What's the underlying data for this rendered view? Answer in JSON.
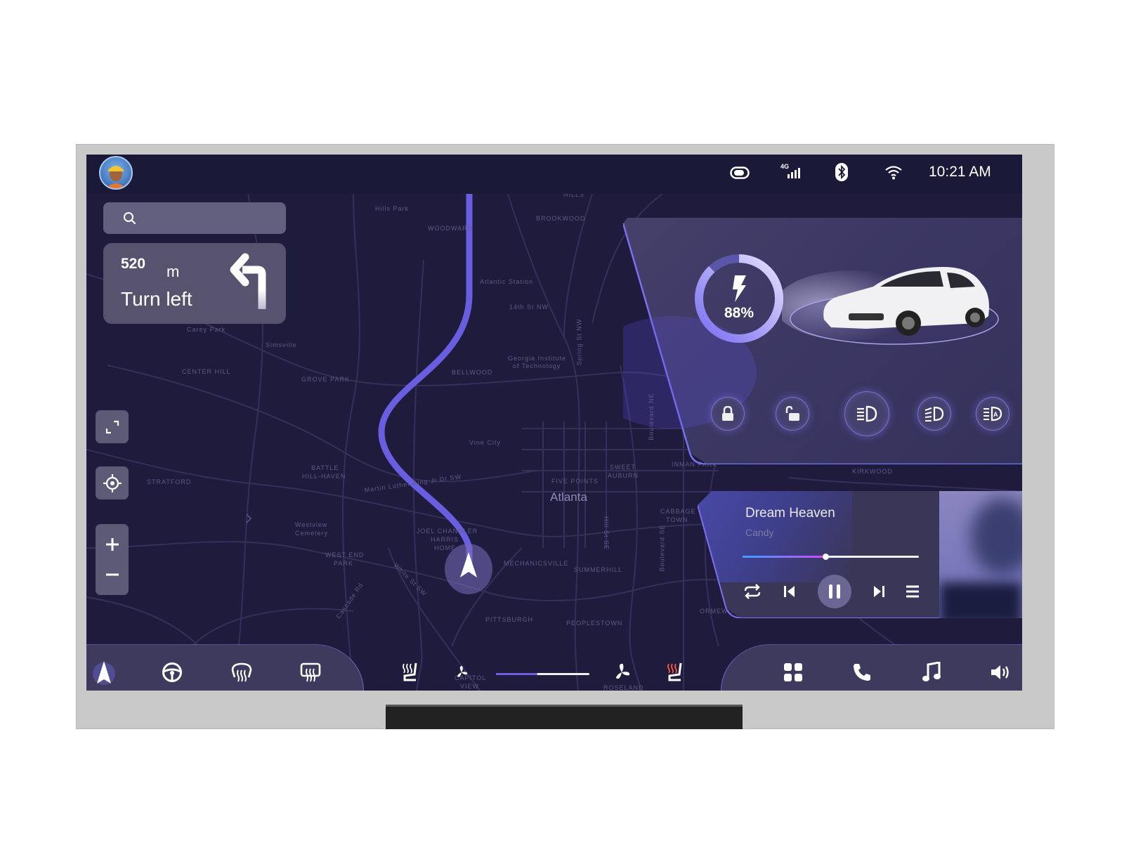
{
  "status_bar": {
    "icons": [
      "toggle-icon",
      "4g-signal-icon",
      "bluetooth-icon",
      "wifi-icon"
    ],
    "signal_label": "4G",
    "time": "10:21 AM"
  },
  "search": {
    "placeholder": "",
    "value": ""
  },
  "navigation": {
    "distance": "520",
    "unit": "m",
    "instruction": "Turn left",
    "maneuver_icon": "turn-left-arrow-icon"
  },
  "map": {
    "city_label": "Atlanta",
    "labels": [
      "Hills Park",
      "WOODWARD",
      "BROOKWOOD",
      "HILLS",
      "Atlantic Station",
      "14th St NW",
      "Georgia Institute",
      "of Technology",
      "BELLWOOD",
      "Simsville",
      "CENTER HILL",
      "GROVE PARK",
      "Vine City",
      "BATTLE",
      "HILL-HAVEN",
      "STRATFORD",
      "Martin Luther King Jr Dr SW",
      "FIVE POINTS",
      "SWEET",
      "AUBURN",
      "INMAN PARK",
      "KIRKWOOD",
      "Westview",
      "Cemetery",
      "JOEL CHANDLER",
      "HARRIS",
      "HOME",
      "WEST END",
      "PARK",
      "MECHANICSVILLE",
      "SUMMERHILL",
      "CABBAGE",
      "TOWN",
      "PITTSBURGH",
      "PEOPLESTOWN",
      "ORMEWOOD",
      "CAPITOL",
      "VIEW",
      "ROSELAND",
      "Spring St NW",
      "Boulevard NE",
      "Hill St SE",
      "Boulevard SE",
      "White St SW",
      "Cascade Rd",
      "Carey Park"
    ],
    "controls": [
      "fullscreen-icon",
      "locate-icon",
      "zoom-in-icon",
      "zoom-out-icon"
    ]
  },
  "vehicle": {
    "battery_percent_label": "88%",
    "battery_level": 0.88,
    "buttons": [
      "lock",
      "unlock",
      "low-beam",
      "high-beam",
      "auto-headlight"
    ],
    "accent": "#8b7ff0"
  },
  "music": {
    "title": "Dream Heaven",
    "artist": "Candy",
    "progress": 0.47,
    "state": "playing",
    "controls": [
      "repeat",
      "previous",
      "pause",
      "next",
      "playlist"
    ]
  },
  "dock": {
    "left": [
      "navigation",
      "steering-wheel-heat",
      "front-defrost",
      "rear-defrost"
    ],
    "climate": {
      "left_seat_heat": "off",
      "fan_level": 0.44,
      "right_seat_heat": "on",
      "heat_color": "#ff5a3a"
    },
    "right": [
      "apps",
      "phone",
      "music",
      "volume"
    ]
  }
}
